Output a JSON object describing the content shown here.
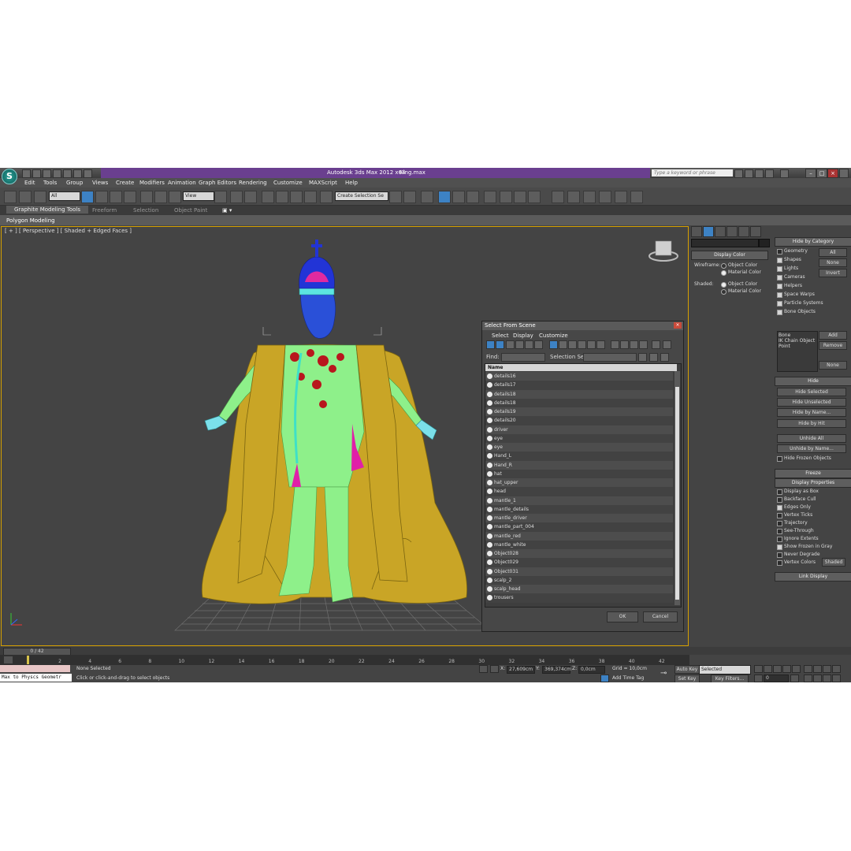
{
  "window": {
    "app_title": "Autodesk 3ds Max  2012 x64",
    "file_name": "King.max",
    "search_placeholder": "Type a keyword or phrase"
  },
  "menu": [
    "Edit",
    "Tools",
    "Group",
    "Views",
    "Create",
    "Modifiers",
    "Animation",
    "Graph Editors",
    "Rendering",
    "Customize",
    "MAXScript",
    "Help"
  ],
  "toolbar": {
    "filter_value": "All",
    "coord_value": "View",
    "selection_set": "Create Selection Se"
  },
  "ribbon": {
    "tabs": [
      "Graphite Modeling Tools",
      "Freeform",
      "Selection",
      "Object Paint"
    ],
    "subtab": "Polygon Modeling"
  },
  "viewport": {
    "label": "[ + ] [ Perspective ] [ Shaded + Edged Faces ]"
  },
  "dialog": {
    "title": "Select From Scene",
    "menus": [
      "Select",
      "Display",
      "Customize"
    ],
    "find_label": "Find:",
    "selection_set_label": "Selection Set:",
    "column_name": "Name",
    "objects": [
      "details16",
      "details17",
      "details18",
      "details18",
      "details19",
      "details20",
      "driver",
      "eye",
      "eye",
      "Hand_L",
      "Hand_R",
      "hat",
      "hat_upper",
      "head",
      "mantle_1",
      "mantle_details",
      "mantle_driver",
      "mantle_part_004",
      "mantle_red",
      "mantle_white",
      "Object028",
      "Object029",
      "Object031",
      "scalp_2",
      "scalp_head",
      "trousers"
    ],
    "ok": "OK",
    "cancel": "Cancel"
  },
  "display_color": {
    "title": "Display Color",
    "wireframe_label": "Wireframe:",
    "shaded_label": "Shaded:",
    "object_color": "Object Color",
    "material_color": "Material Color"
  },
  "hide_by_category": {
    "title": "Hide by Category",
    "items": [
      {
        "label": "Geometry",
        "checked": false
      },
      {
        "label": "Shapes",
        "checked": true
      },
      {
        "label": "Lights",
        "checked": true
      },
      {
        "label": "Cameras",
        "checked": true
      },
      {
        "label": "Helpers",
        "checked": true
      },
      {
        "label": "Space Warps",
        "checked": true
      },
      {
        "label": "Particle Systems",
        "checked": true
      },
      {
        "label": "Bone Objects",
        "checked": true
      }
    ],
    "all": "All",
    "none": "None",
    "invert": "Invert",
    "list_lines": [
      "Bone",
      "IK Chain Object",
      "Point"
    ],
    "add": "Add",
    "remove": "Remove",
    "none2": "None"
  },
  "hide": {
    "title": "Hide",
    "buttons": [
      "Hide Selected",
      "Hide Unselected",
      "Hide by Name...",
      "Hide by Hit",
      "Unhide All",
      "Unhide by Name..."
    ],
    "hide_frozen": "Hide Frozen Objects"
  },
  "freeze": {
    "title": "Freeze"
  },
  "display_properties": {
    "title": "Display Properties",
    "items": [
      {
        "label": "Display as Box",
        "checked": false
      },
      {
        "label": "Backface Cull",
        "checked": false
      },
      {
        "label": "Edges Only",
        "checked": true
      },
      {
        "label": "Vertex Ticks",
        "checked": false
      },
      {
        "label": "Trajectory",
        "checked": false
      },
      {
        "label": "See-Through",
        "checked": false
      },
      {
        "label": "Ignore Extents",
        "checked": false
      },
      {
        "label": "Show Frozen in Gray",
        "checked": true
      },
      {
        "label": "Never Degrade",
        "checked": false
      },
      {
        "label": "Vertex Colors",
        "checked": false
      }
    ],
    "shaded": "Shaded"
  },
  "link_display": {
    "title": "Link Display"
  },
  "timeline": {
    "frame": "0 / 42",
    "ticks": [
      "0",
      "2",
      "4",
      "6",
      "8",
      "10",
      "12",
      "14",
      "16",
      "18",
      "20",
      "22",
      "24",
      "26",
      "28",
      "30",
      "32",
      "34",
      "36",
      "38",
      "40",
      "42"
    ]
  },
  "status": {
    "maxscript": "Max to Physcs Geometr",
    "none_selected": "None Selected",
    "prompt": "Click or click-and-drag to select objects",
    "x": "27,609cm",
    "y": "369,374cm",
    "z": "0,0cm",
    "grid": "Grid = 10,0cm",
    "add_time_tag": "Add Time Tag",
    "auto_key": "Auto Key",
    "selected": "Selected",
    "set_key": "Set Key",
    "key_filters": "Key Filters...",
    "frame_value": "0"
  },
  "colors": {
    "title_purple": "#6a3f8f",
    "active_blue": "#3d82c4",
    "viewport_border": "#d6a000",
    "mantle_gold": "#c9a526",
    "body_green": "#8ef08a",
    "crown_blue": "#2234d6"
  }
}
